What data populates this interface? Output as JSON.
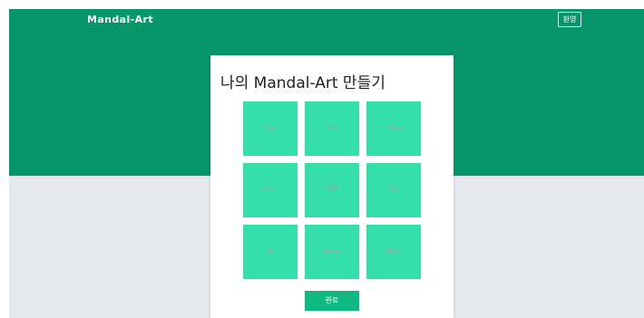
{
  "header": {
    "brand": "Mandal-Art",
    "greeting_button": "환영"
  },
  "card": {
    "title": "나의 Mandal-Art 만들기",
    "cells": [
      {
        "label": "One"
      },
      {
        "label": "Two"
      },
      {
        "label": "Three"
      },
      {
        "label": "Four"
      },
      {
        "label": "목표"
      },
      {
        "label": "Five"
      },
      {
        "label": "Six"
      },
      {
        "label": "Seven"
      },
      {
        "label": "Eight"
      }
    ],
    "submit_button": "완료"
  },
  "colors": {
    "header_bg": "#079669",
    "page_bg": "#e5e9ee",
    "cell_bg": "#34dfa9",
    "button_bg": "#10b981"
  }
}
